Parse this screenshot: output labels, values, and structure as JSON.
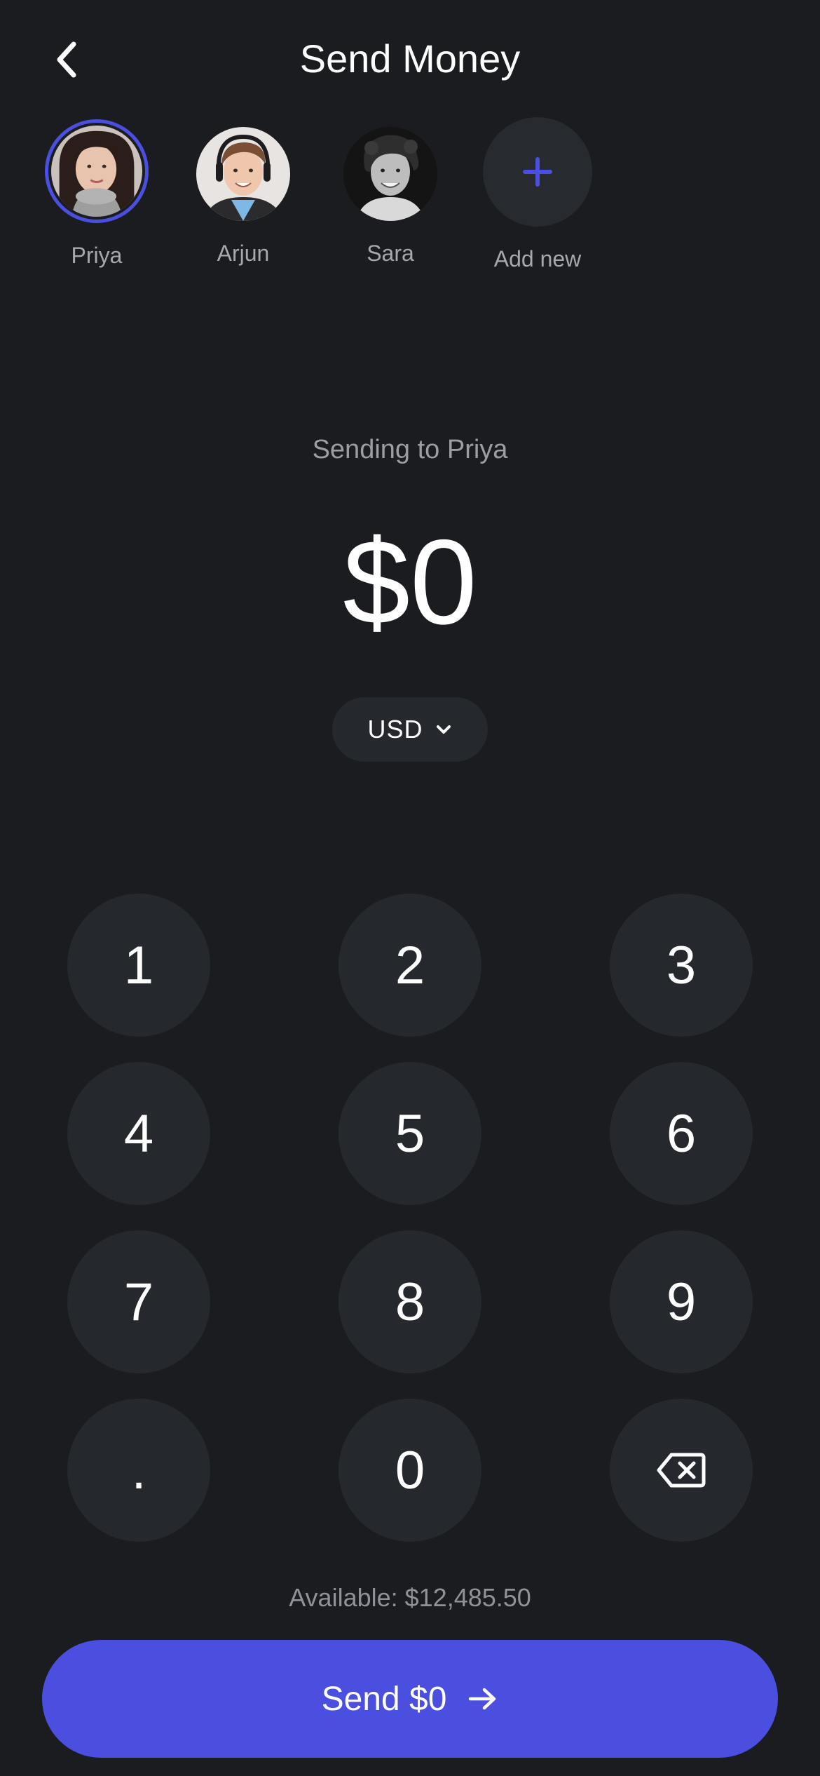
{
  "header": {
    "title": "Send Money",
    "back_icon": "chevron-left-icon"
  },
  "recipients": [
    {
      "name": "Priya",
      "selected": true
    },
    {
      "name": "Arjun",
      "selected": false
    },
    {
      "name": "Sara",
      "selected": false
    },
    {
      "name": "Add new",
      "icon": "plus-icon"
    }
  ],
  "transfer": {
    "sending_to": "Sending to Priya",
    "amount": "$0",
    "currency": "USD"
  },
  "keypad": {
    "keys": [
      "1",
      "2",
      "3",
      "4",
      "5",
      "6",
      "7",
      "8",
      "9",
      ".",
      "0",
      "backspace"
    ]
  },
  "footer": {
    "available": "Available: $12,485.50",
    "send_label": "Send $0"
  },
  "colors": {
    "background": "#1a1c1f",
    "accent": "#4a4fdf",
    "surface": "#25282c",
    "muted_text": "#9b9ea4"
  }
}
